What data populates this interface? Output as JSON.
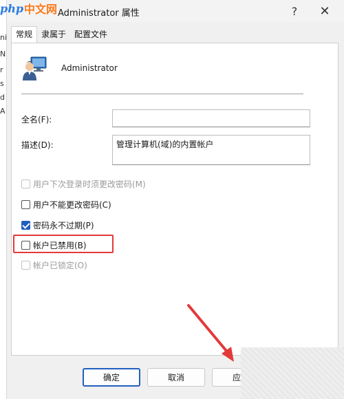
{
  "watermark": {
    "part1": "php",
    "part2": "中文网"
  },
  "window": {
    "title": "Administrator 属性",
    "help": "?",
    "close": "✕"
  },
  "background_fragments": [
    "ni",
    "N",
    "r",
    "s",
    "d",
    "A"
  ],
  "tabs": [
    {
      "label": "常规",
      "active": true
    },
    {
      "label": "隶属于",
      "active": false
    },
    {
      "label": "配置文件",
      "active": false
    }
  ],
  "user": {
    "name": "Administrator",
    "icon": "user-monitor-icon"
  },
  "fields": {
    "fullname": {
      "label": "全名(F):",
      "value": ""
    },
    "description": {
      "label": "描述(D):",
      "value": "管理计算机(域)的内置帐户"
    }
  },
  "checkboxes": [
    {
      "label": "用户下次登录时须更改密码(M)",
      "checked": false,
      "disabled": true
    },
    {
      "label": "用户不能更改密码(C)",
      "checked": false,
      "disabled": false
    },
    {
      "label": "密码永不过期(P)",
      "checked": true,
      "disabled": false
    },
    {
      "label": "帐户已禁用(B)",
      "checked": false,
      "disabled": false
    },
    {
      "label": "帐户已锁定(O)",
      "checked": false,
      "disabled": true
    }
  ],
  "buttons": {
    "ok": "确定",
    "cancel": "取消",
    "apply": "应用"
  },
  "colors": {
    "accent": "#1f5fbf",
    "annotation": "#e23a3a"
  }
}
